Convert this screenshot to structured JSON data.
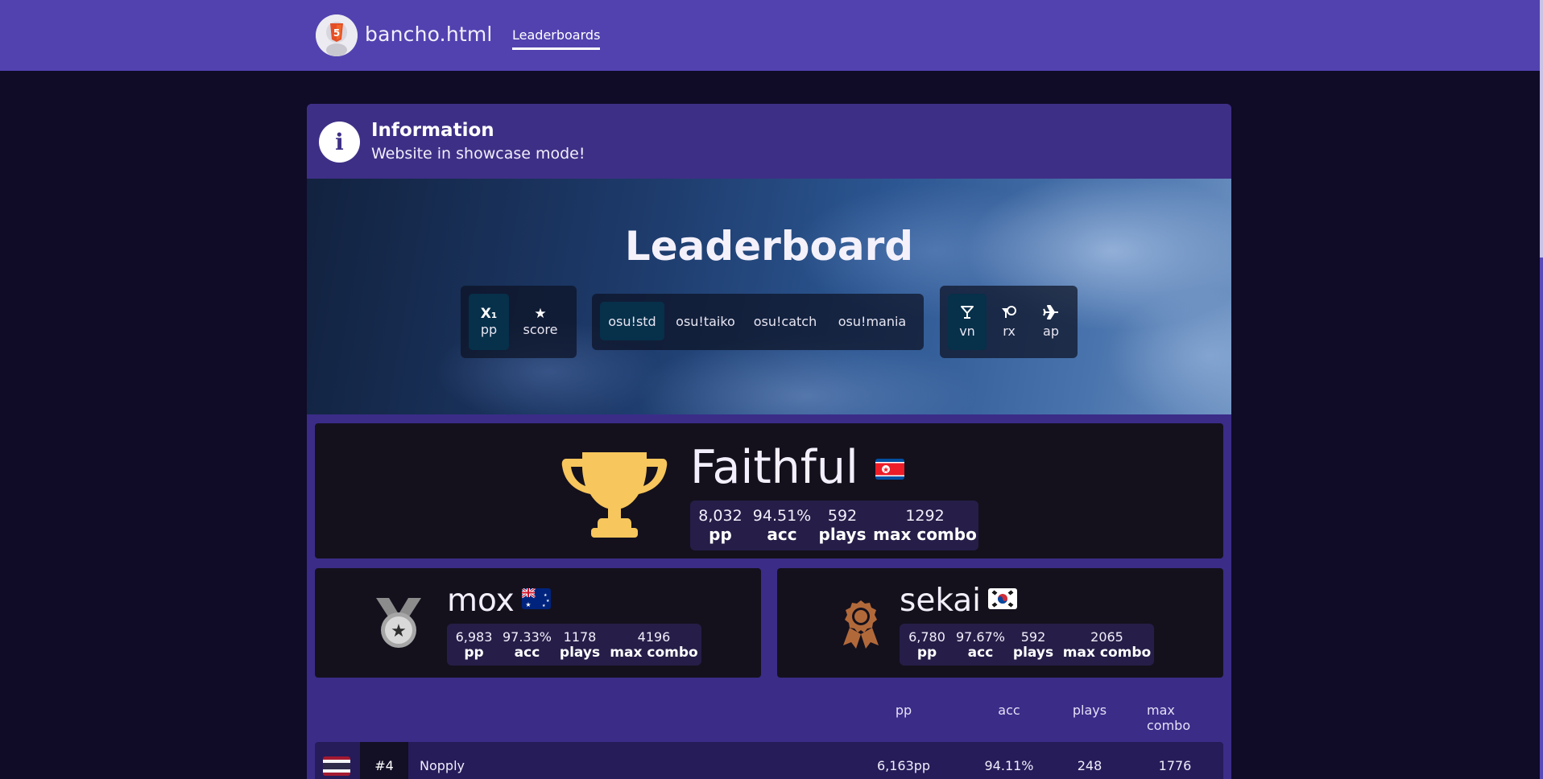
{
  "nav": {
    "brand": "bancho.html",
    "links": [
      "Leaderboards"
    ]
  },
  "info": {
    "title": "Information",
    "message": "Website in showcase mode!"
  },
  "leaderboard": {
    "title": "Leaderboard",
    "sort_options": [
      {
        "icon": "X₁",
        "label": "pp",
        "active": true
      },
      {
        "icon": "★",
        "label": "score",
        "active": false
      }
    ],
    "modes": [
      {
        "label": "osu!std",
        "active": true
      },
      {
        "label": "osu!taiko",
        "active": false
      },
      {
        "label": "osu!catch",
        "active": false
      },
      {
        "label": "osu!mania",
        "active": false
      }
    ],
    "mods": [
      {
        "icon": "cocktail-icon",
        "label": "vn",
        "active": true
      },
      {
        "icon": "whistle-icon",
        "label": "rx",
        "active": false
      },
      {
        "icon": "plane-icon",
        "label": "ap",
        "active": false
      }
    ]
  },
  "podium": {
    "first": {
      "name": "Faithful",
      "flag": "north-korea",
      "stats": [
        {
          "value": "8,032",
          "label": "pp"
        },
        {
          "value": "94.51%",
          "label": "acc"
        },
        {
          "value": "592",
          "label": "plays"
        },
        {
          "value": "1292",
          "label": "max combo"
        }
      ]
    },
    "second": {
      "name": "mox",
      "flag": "australia",
      "stats": [
        {
          "value": "6,983",
          "label": "pp"
        },
        {
          "value": "97.33%",
          "label": "acc"
        },
        {
          "value": "1178",
          "label": "plays"
        },
        {
          "value": "4196",
          "label": "max combo"
        }
      ]
    },
    "third": {
      "name": "sekai",
      "flag": "south-korea",
      "stats": [
        {
          "value": "6,780",
          "label": "pp"
        },
        {
          "value": "97.67%",
          "label": "acc"
        },
        {
          "value": "592",
          "label": "plays"
        },
        {
          "value": "2065",
          "label": "max combo"
        }
      ]
    }
  },
  "table": {
    "columns": [
      "pp",
      "acc",
      "plays",
      "max combo"
    ],
    "rows": [
      {
        "flag": "thailand",
        "rank": "#4",
        "name": "Nopply",
        "pp": "6,163pp",
        "acc": "94.11%",
        "plays": "248",
        "max_combo": "1776"
      }
    ]
  },
  "colors": {
    "navbar": "#5242b0",
    "background": "#100b27",
    "panel": "#3b2c88",
    "card": "#14111d",
    "gold": "#f7c65c",
    "silver": "#9a9a9a",
    "bronze": "#b2693a"
  }
}
